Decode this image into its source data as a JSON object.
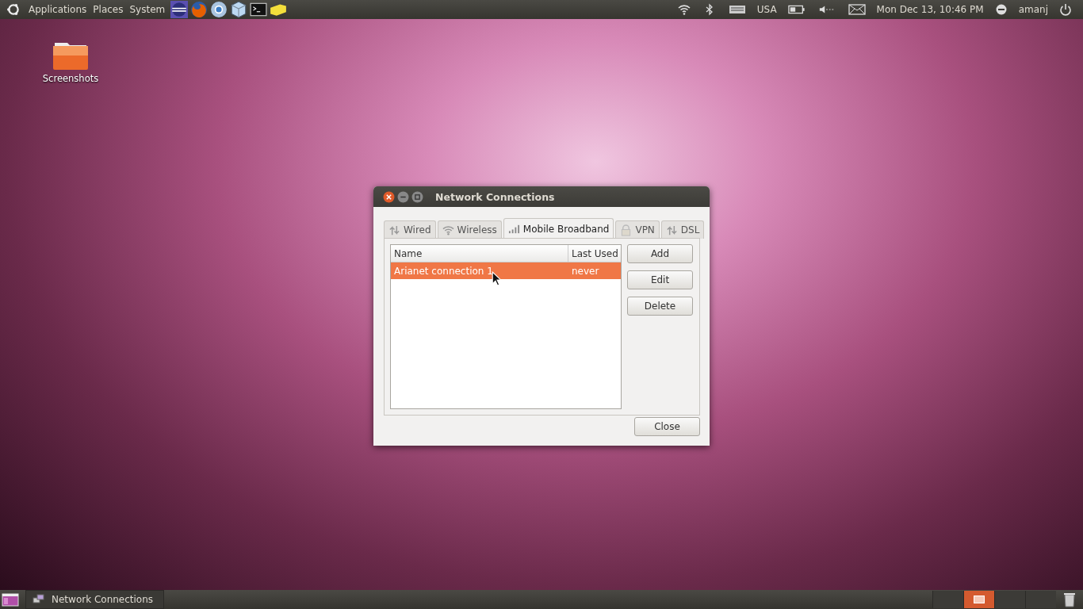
{
  "top_panel": {
    "menus": [
      "Applications",
      "Places",
      "System"
    ],
    "keyboard_layout": "USA",
    "clock": "Mon Dec 13, 10:46 PM",
    "user": "amanj"
  },
  "desktop_icons": [
    {
      "label": "Screenshots"
    }
  ],
  "dialog": {
    "title": "Network Connections",
    "tabs": [
      {
        "label": "Wired",
        "kind": "wired",
        "selected": false
      },
      {
        "label": "Wireless",
        "kind": "wireless",
        "selected": false
      },
      {
        "label": "Mobile Broadband",
        "kind": "mobile",
        "selected": true
      },
      {
        "label": "VPN",
        "kind": "vpn",
        "selected": false
      },
      {
        "label": "DSL",
        "kind": "dsl",
        "selected": false
      }
    ],
    "columns": [
      "Name",
      "Last Used"
    ],
    "rows": [
      {
        "cells": [
          "Arianet connection 1",
          "never"
        ],
        "selected": true
      }
    ],
    "buttons": [
      "Add",
      "Edit",
      "Delete"
    ],
    "close_button": "Close"
  },
  "bottom_panel": {
    "tasks": [
      {
        "label": "Network Connections"
      }
    ],
    "workspaces": [
      {
        "selected": false
      },
      {
        "selected": true
      },
      {
        "selected": false
      },
      {
        "selected": false
      }
    ]
  }
}
